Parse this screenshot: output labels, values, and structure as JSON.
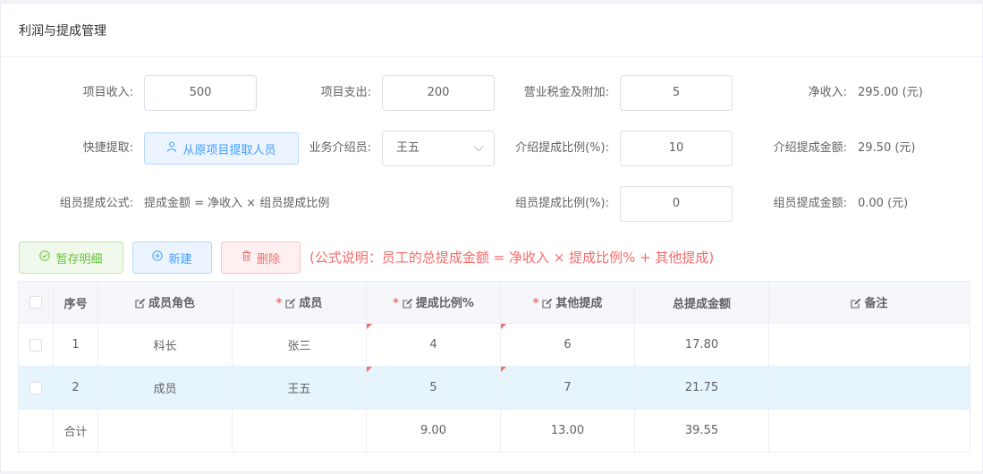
{
  "header": {
    "title": "利润与提成管理"
  },
  "form": {
    "income_label": "项目收入:",
    "income_value": "500",
    "expense_label": "项目支出:",
    "expense_value": "200",
    "tax_label": "营业税金及附加:",
    "tax_value": "5",
    "net_label": "净收入:",
    "net_value": "295.00 (元)",
    "quick_label": "快捷提取:",
    "quick_button": "从原项目提取人员",
    "referrer_label": "业务介绍员:",
    "referrer_value": "王五",
    "intro_ratio_label": "介绍提成比例(%):",
    "intro_ratio_value": "10",
    "intro_amount_label": "介绍提成金额:",
    "intro_amount_value": "29.50 (元)",
    "member_formula_label": "组员提成公式:",
    "member_formula_value": "提成金额 = 净收入 × 组员提成比例",
    "member_ratio_label": "组员提成比例(%):",
    "member_ratio_value": "0",
    "member_amount_label": "组员提成金额:",
    "member_amount_value": "0.00 (元)"
  },
  "toolbar": {
    "save_label": "暂存明细",
    "new_label": "新建",
    "delete_label": "删除",
    "formula_note": "(公式说明：员工的总提成金额 = 净收入 × 提成比例% + 其他提成)"
  },
  "table": {
    "headers": {
      "index": "序号",
      "role": "成员角色",
      "member": "成员",
      "ratio": "提成比例%",
      "other": "其他提成",
      "total": "总提成金额",
      "remark": "备注"
    },
    "rows": [
      {
        "index": "1",
        "role": "科长",
        "member": "张三",
        "ratio": "4",
        "other": "6",
        "total": "17.80",
        "remark": ""
      },
      {
        "index": "2",
        "role": "成员",
        "member": "王五",
        "ratio": "5",
        "other": "7",
        "total": "21.75",
        "remark": ""
      }
    ],
    "summary": {
      "label": "合计",
      "ratio": "9.00",
      "other": "13.00",
      "total": "39.55"
    }
  },
  "colors": {
    "primary": "#409eff",
    "success": "#67c23a",
    "danger": "#f56c6c",
    "highlight_row": "#e6f4fb"
  }
}
